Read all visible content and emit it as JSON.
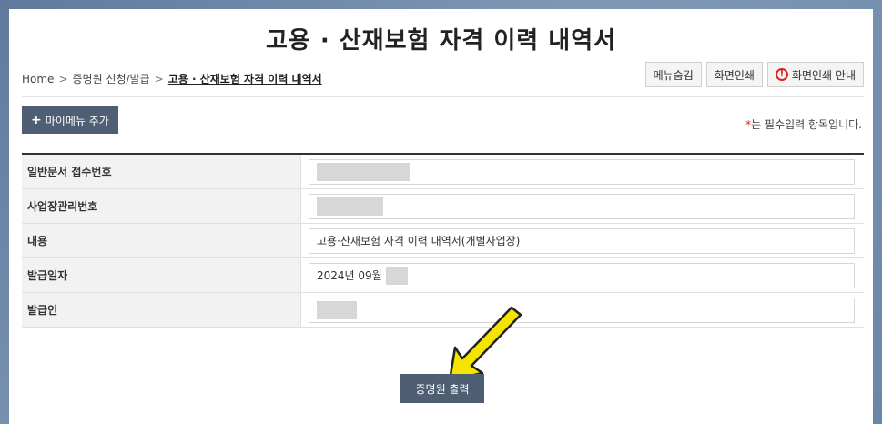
{
  "page": {
    "title": "고용 · 산재보험 자격 이력 내역서"
  },
  "breadcrumb": {
    "items": [
      "Home",
      "증명원 신청/발급",
      "고용 · 산재보험 자격 이력 내역서"
    ],
    "separator": ">"
  },
  "toolbar": {
    "hide_menu_label": "메뉴숨김",
    "print_label": "화면인쇄",
    "print_guide_label": "화면인쇄 안내",
    "print_guide_icon": "!"
  },
  "mymenu": {
    "plus": "+",
    "label": "마이메뉴 추가"
  },
  "required_note": {
    "star": "*",
    "text": "는 필수입력 항목입니다."
  },
  "form": {
    "rows": [
      {
        "label": "일반문서 접수번호",
        "value": ""
      },
      {
        "label": "사업장관리번호",
        "value": ""
      },
      {
        "label": "내용",
        "value": "고용·산재보험 자격 이력 내역서(개별사업장)"
      },
      {
        "label": "발급일자",
        "value": "2024년 09월"
      },
      {
        "label": "발급인",
        "value": ""
      }
    ]
  },
  "actions": {
    "print_certificate_label": "증명원 출력"
  },
  "colors": {
    "primary_button": "#4e5f73",
    "arrow": "#f5e400",
    "warning": "#e02020"
  }
}
